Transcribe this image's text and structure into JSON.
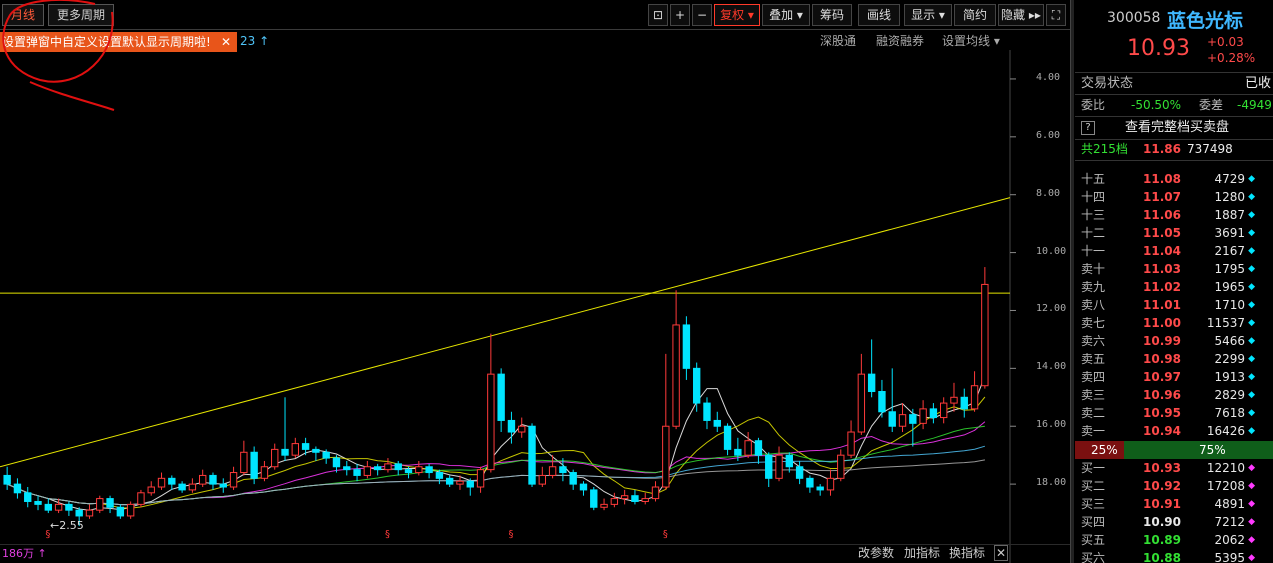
{
  "tabs": {
    "monthly": "月线",
    "more": "更多周期"
  },
  "tools": {
    "fuquan": "复权",
    "overlay": "叠加",
    "chips": "筹码",
    "draw": "画线",
    "display": "显示",
    "simple": "简约",
    "hide": "隐藏"
  },
  "tip": {
    "text": "设置弹窗中自定义设置默认显示周期啦!",
    "close": "✕",
    "suffix": "23"
  },
  "subbar": {
    "shen": "深股通",
    "rzrq": "融资融券",
    "ma": "设置均线"
  },
  "axis": [
    "18.00",
    "16.00",
    "14.00",
    "12.00",
    "10.00",
    "8.00",
    "6.00",
    "4.00"
  ],
  "low_label": "←2.55",
  "bottom": {
    "vol": "186万",
    "params": "改参数",
    "add": "加指标",
    "swap": "换指标"
  },
  "quote": {
    "code": "300058",
    "name": "蓝色光标",
    "price": "10.93",
    "change": "+0.03",
    "pct": "+0.28%"
  },
  "status": {
    "label": "交易状态",
    "value": "已收"
  },
  "weibi": {
    "label": "委比",
    "value": "-50.50%",
    "label2": "委差",
    "value2": "-4949"
  },
  "full_book": "查看完整档买卖盘",
  "total": {
    "label": "共215档",
    "price": "11.86",
    "vol": "737498"
  },
  "asks": [
    {
      "l": "十五",
      "p": "11.08",
      "v": "4729"
    },
    {
      "l": "十四",
      "p": "11.07",
      "v": "1280"
    },
    {
      "l": "十三",
      "p": "11.06",
      "v": "1887"
    },
    {
      "l": "十二",
      "p": "11.05",
      "v": "3691"
    },
    {
      "l": "十一",
      "p": "11.04",
      "v": "2167"
    },
    {
      "l": "卖十",
      "p": "11.03",
      "v": "1795"
    },
    {
      "l": "卖九",
      "p": "11.02",
      "v": "1965"
    },
    {
      "l": "卖八",
      "p": "11.01",
      "v": "1710"
    },
    {
      "l": "卖七",
      "p": "11.00",
      "v": "11537"
    },
    {
      "l": "卖六",
      "p": "10.99",
      "v": "5466"
    },
    {
      "l": "卖五",
      "p": "10.98",
      "v": "2299"
    },
    {
      "l": "卖四",
      "p": "10.97",
      "v": "1913"
    },
    {
      "l": "卖三",
      "p": "10.96",
      "v": "2829"
    },
    {
      "l": "卖二",
      "p": "10.95",
      "v": "7618"
    },
    {
      "l": "卖一",
      "p": "10.94",
      "v": "16426"
    }
  ],
  "ratio": {
    "left": "25%",
    "right": "75%"
  },
  "bids": [
    {
      "l": "买一",
      "p": "10.93",
      "v": "12210",
      "c": "r"
    },
    {
      "l": "买二",
      "p": "10.92",
      "v": "17208",
      "c": "r"
    },
    {
      "l": "买三",
      "p": "10.91",
      "v": "4891",
      "c": "r"
    },
    {
      "l": "买四",
      "p": "10.90",
      "v": "7212",
      "c": "w"
    },
    {
      "l": "买五",
      "p": "10.89",
      "v": "2062",
      "c": "g"
    },
    {
      "l": "买六",
      "p": "10.88",
      "v": "5395",
      "c": "g"
    }
  ],
  "colors": {
    "up": "#ff3a3a",
    "down": "#00e5ff",
    "ask_dot": "#00e5ff",
    "bid_dot": "#ff3aff"
  },
  "chart_data": {
    "type": "candlestick",
    "period": "月线",
    "ylim": [
      2,
      19
    ],
    "yticks": [
      4,
      6,
      8,
      10,
      12,
      14,
      16,
      18
    ],
    "horizontal_line": 10.6,
    "trend_line": [
      [
        0,
        4.6
      ],
      [
        1010,
        13.9
      ]
    ],
    "low_marker": 2.55,
    "candles": [
      [
        4.3,
        4.0,
        4.6,
        3.8
      ],
      [
        4.0,
        3.7,
        4.2,
        3.5
      ],
      [
        3.7,
        3.4,
        3.9,
        3.2
      ],
      [
        3.4,
        3.3,
        3.6,
        3.1
      ],
      [
        3.3,
        3.1,
        3.5,
        3.0
      ],
      [
        3.1,
        3.3,
        3.5,
        3.0
      ],
      [
        3.3,
        3.1,
        3.4,
        2.9
      ],
      [
        3.1,
        2.9,
        3.2,
        2.55
      ],
      [
        2.9,
        3.1,
        3.3,
        2.8
      ],
      [
        3.1,
        3.5,
        3.6,
        3.0
      ],
      [
        3.5,
        3.2,
        3.6,
        3.0
      ],
      [
        3.2,
        2.9,
        3.3,
        2.8
      ],
      [
        2.9,
        3.3,
        3.4,
        2.8
      ],
      [
        3.3,
        3.7,
        3.8,
        3.2
      ],
      [
        3.7,
        3.9,
        4.1,
        3.6
      ],
      [
        3.9,
        4.2,
        4.4,
        3.8
      ],
      [
        4.2,
        4.0,
        4.3,
        3.8
      ],
      [
        4.0,
        3.8,
        4.1,
        3.7
      ],
      [
        3.8,
        4.0,
        4.2,
        3.7
      ],
      [
        4.0,
        4.3,
        4.5,
        3.9
      ],
      [
        4.3,
        4.0,
        4.4,
        3.8
      ],
      [
        4.0,
        3.9,
        4.2,
        3.7
      ],
      [
        3.9,
        4.4,
        4.6,
        3.8
      ],
      [
        4.4,
        5.1,
        5.5,
        4.3
      ],
      [
        5.1,
        4.2,
        5.3,
        4.0
      ],
      [
        4.2,
        4.6,
        4.8,
        4.1
      ],
      [
        4.6,
        5.2,
        5.4,
        4.5
      ],
      [
        5.2,
        5.0,
        7.0,
        4.8
      ],
      [
        5.0,
        5.4,
        5.6,
        4.9
      ],
      [
        5.4,
        5.2,
        5.6,
        5.0
      ],
      [
        5.2,
        5.1,
        5.3,
        4.8
      ],
      [
        5.1,
        4.9,
        5.2,
        4.7
      ],
      [
        4.9,
        4.6,
        5.0,
        4.4
      ],
      [
        4.6,
        4.5,
        4.8,
        4.3
      ],
      [
        4.5,
        4.3,
        4.7,
        4.1
      ],
      [
        4.3,
        4.6,
        4.8,
        4.2
      ],
      [
        4.6,
        4.5,
        4.7,
        4.3
      ],
      [
        4.5,
        4.7,
        4.9,
        4.4
      ],
      [
        4.7,
        4.5,
        4.8,
        4.3
      ],
      [
        4.5,
        4.4,
        4.6,
        4.2
      ],
      [
        4.4,
        4.6,
        4.8,
        4.3
      ],
      [
        4.6,
        4.4,
        4.7,
        4.2
      ],
      [
        4.4,
        4.2,
        4.5,
        4.0
      ],
      [
        4.2,
        4.0,
        4.3,
        3.9
      ],
      [
        4.0,
        4.1,
        4.3,
        3.8
      ],
      [
        4.1,
        3.9,
        4.2,
        3.6
      ],
      [
        3.9,
        4.5,
        4.6,
        3.7
      ],
      [
        4.5,
        7.8,
        9.2,
        4.4
      ],
      [
        7.8,
        6.2,
        8.0,
        5.8
      ],
      [
        6.2,
        5.8,
        6.5,
        5.4
      ],
      [
        5.8,
        6.0,
        6.3,
        5.6
      ],
      [
        6.0,
        4.0,
        6.1,
        3.9
      ],
      [
        4.0,
        4.3,
        4.6,
        3.9
      ],
      [
        4.3,
        4.6,
        5.0,
        4.2
      ],
      [
        4.6,
        4.4,
        4.9,
        4.1
      ],
      [
        4.4,
        4.0,
        4.5,
        3.8
      ],
      [
        4.0,
        3.8,
        4.1,
        3.6
      ],
      [
        3.8,
        3.2,
        3.9,
        3.1
      ],
      [
        3.2,
        3.3,
        3.5,
        3.1
      ],
      [
        3.3,
        3.5,
        3.7,
        3.2
      ],
      [
        3.5,
        3.6,
        3.8,
        3.3
      ],
      [
        3.6,
        3.4,
        3.8,
        3.3
      ],
      [
        3.4,
        3.5,
        3.7,
        3.3
      ],
      [
        3.5,
        3.9,
        4.1,
        3.4
      ],
      [
        3.9,
        6.0,
        8.5,
        3.8
      ],
      [
        6.0,
        9.5,
        10.7,
        5.9
      ],
      [
        9.5,
        8.0,
        9.8,
        7.6
      ],
      [
        8.0,
        6.8,
        8.2,
        6.5
      ],
      [
        6.8,
        6.2,
        7.0,
        5.9
      ],
      [
        6.2,
        6.0,
        6.5,
        5.8
      ],
      [
        6.0,
        5.2,
        6.1,
        5.0
      ],
      [
        5.2,
        5.0,
        5.6,
        4.8
      ],
      [
        5.0,
        5.5,
        5.8,
        4.9
      ],
      [
        5.5,
        5.0,
        5.6,
        4.7
      ],
      [
        5.0,
        4.2,
        5.1,
        3.9
      ],
      [
        4.2,
        5.0,
        5.3,
        4.1
      ],
      [
        5.0,
        4.6,
        5.1,
        4.4
      ],
      [
        4.6,
        4.2,
        4.8,
        4.0
      ],
      [
        4.2,
        3.9,
        4.3,
        3.7
      ],
      [
        3.9,
        3.8,
        4.0,
        3.6
      ],
      [
        3.8,
        4.2,
        4.5,
        3.6
      ],
      [
        4.2,
        5.0,
        5.2,
        4.1
      ],
      [
        5.0,
        5.8,
        6.2,
        4.9
      ],
      [
        5.8,
        7.8,
        8.5,
        5.7
      ],
      [
        7.8,
        7.2,
        9.0,
        7.0
      ],
      [
        7.2,
        6.5,
        7.6,
        6.3
      ],
      [
        6.5,
        6.0,
        8.0,
        5.8
      ],
      [
        6.0,
        6.4,
        6.8,
        5.8
      ],
      [
        6.4,
        6.1,
        6.6,
        5.3
      ],
      [
        6.1,
        6.6,
        6.9,
        5.9
      ],
      [
        6.6,
        6.3,
        6.8,
        6.1
      ],
      [
        6.3,
        6.8,
        7.0,
        6.1
      ],
      [
        6.8,
        7.0,
        7.5,
        6.5
      ],
      [
        7.0,
        6.6,
        7.3,
        6.3
      ],
      [
        6.6,
        7.4,
        7.9,
        6.5
      ],
      [
        7.4,
        10.9,
        11.5,
        7.3
      ]
    ],
    "volume_label": "186万"
  }
}
